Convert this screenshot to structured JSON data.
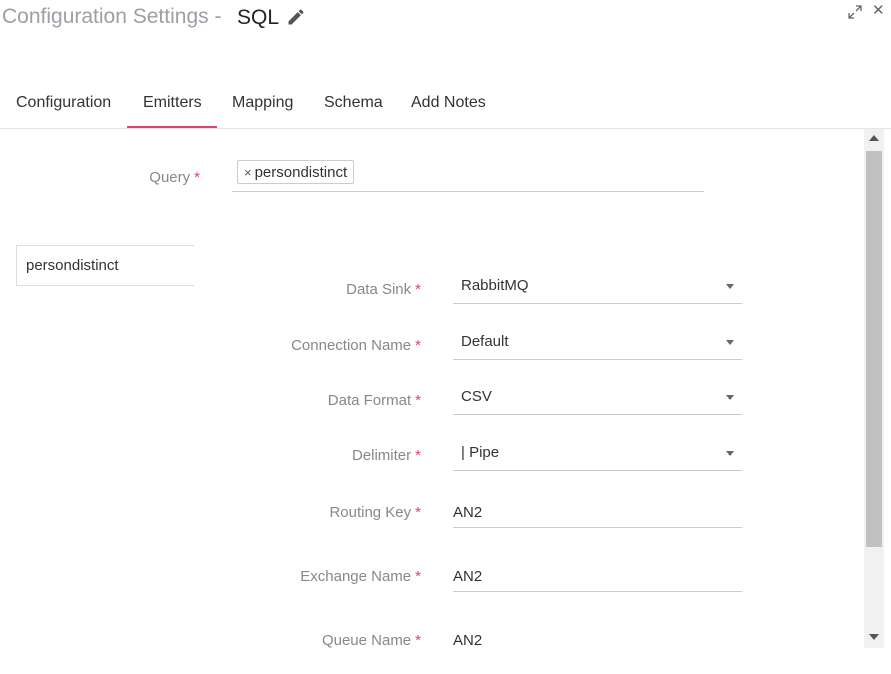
{
  "header": {
    "title_prefix": "Configuration Settings -",
    "title_main": "SQL",
    "close_glyph": "✕"
  },
  "tabs": [
    {
      "label": "Configuration",
      "active": false
    },
    {
      "label": "Emitters",
      "active": true
    },
    {
      "label": "Mapping",
      "active": false
    },
    {
      "label": "Schema",
      "active": false
    },
    {
      "label": "Add Notes",
      "active": false
    }
  ],
  "query": {
    "label": "Query",
    "required": "*",
    "tags": [
      {
        "remove": "×",
        "text": "persondistinct"
      }
    ]
  },
  "side_list": {
    "items": [
      "persondistinct"
    ]
  },
  "form": {
    "data_sink": {
      "label": "Data Sink",
      "value": "RabbitMQ"
    },
    "connection_name": {
      "label": "Connection Name",
      "value": "Default"
    },
    "data_format": {
      "label": "Data Format",
      "value": "CSV"
    },
    "delimiter": {
      "label": "Delimiter",
      "value": "| Pipe"
    },
    "routing_key": {
      "label": "Routing Key",
      "value": "AN2"
    },
    "exchange_name": {
      "label": "Exchange Name",
      "value": "AN2"
    },
    "queue_name": {
      "label": "Queue Name",
      "value": "AN2"
    },
    "required_marker": "*"
  },
  "colors": {
    "accent": "#d9466b",
    "label": "#888888",
    "title_prefix": "#9aa0a6"
  }
}
